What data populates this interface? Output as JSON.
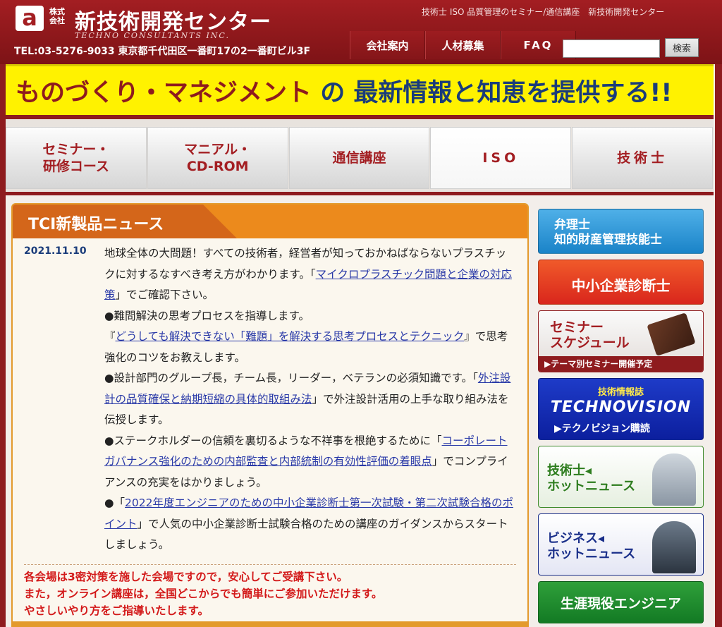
{
  "header": {
    "logo_mark": "a",
    "logo_kabushiki": "株式\n会社",
    "logo_name": "新技術開発センター",
    "logo_english": "TECHNO CONSULTANTS INC.",
    "contact": "TEL:03-5276-9033 東京都千代田区一番町17の2一番町ビル3F",
    "tagline": "技術士 ISO 品質管理のセミナー/通信講座　新技術開発センター",
    "nav": [
      "会社案内",
      "人材募集",
      "FAQ"
    ],
    "search_placeholder": "",
    "search_button": "検索"
  },
  "banner": {
    "part1": "ものづくり・マネジメント",
    "part2": " の 最新情報と知恵を提供する!!"
  },
  "main_nav": [
    {
      "label": "セミナー・\n研修コース"
    },
    {
      "label": "マニアル・\nCD-ROM"
    },
    {
      "label": "通信講座"
    },
    {
      "label": "ISO"
    },
    {
      "label": "技術士"
    }
  ],
  "news": {
    "title": "TCI新製品ニュース",
    "date": "2021.11.10",
    "p1_text": "地球全体の大問題！すべての技術者，経営者が知っておかねばならないプラスチックに対するなすべき考え方がわかります。「",
    "p1_link": "マイクロプラスチック問題と企業の対応策",
    "p1_after": "」でご確認下さい。",
    "p2_bullet": "●難問解決の思考プロセスを指導します。",
    "p2_pre": "『",
    "p2_link": "どうしても解決できない「難題」を解決する思考プロセスとテクニック",
    "p2_after": "』で思考強化のコツをお教えします。",
    "p3_text": "●設計部門のグループ長，チーム長，リーダー，ベテランの必須知識です。「",
    "p3_link": "外注設計の品質確保と納期短縮の具体的取組み法",
    "p3_after": "」で外注設計活用の上手な取り組み法を伝授します。",
    "p4_text": "●ステークホルダーの信頼を裏切るような不祥事を根絶するために「",
    "p4_link": "コーポレートガバナンス強化のための内部監査と内部統制の有効性評価の着眼点",
    "p4_after": "」でコンプライアンスの充実をはかりましょう。",
    "p5_text": "●「",
    "p5_link": "2022年度エンジニアのための中小企業診断士第一次試験・第二次試験合格のポイント",
    "p5_after": "」で人気の中小企業診断士試験合格のための講座のガイダンスからスタートしましょう。",
    "notice": "各会場は3密対策を施した会場ですので，安心してご受講下さい。\nまた，オンライン講座は，全国どこからでも簡単にご参加いただけます。\nやさしいやり方をご指導いたします。"
  },
  "side": {
    "benrishi": "弁理士\n知的財産管理技能士",
    "chusho": "中小企業診断士",
    "seminar": "セミナー\nスケジュール",
    "seminar_foot": "▶テーマ別セミナー開催予定",
    "tv_top": "技術情報誌",
    "tv_main": "TECHNOVISION",
    "tv_foot": "▶テクノビジョン購読",
    "engineer_news": "技術士◂\nホットニュース",
    "business_news": "ビジネス◂\nホットニュース",
    "lifetime": "生涯現役エンジニア"
  },
  "colors": {
    "brand_red": "#a31e22",
    "banner_yellow": "#fff200",
    "news_orange": "#ec8a1c",
    "link_blue": "#2a3aa8",
    "notice_red": "#d31a1a"
  }
}
